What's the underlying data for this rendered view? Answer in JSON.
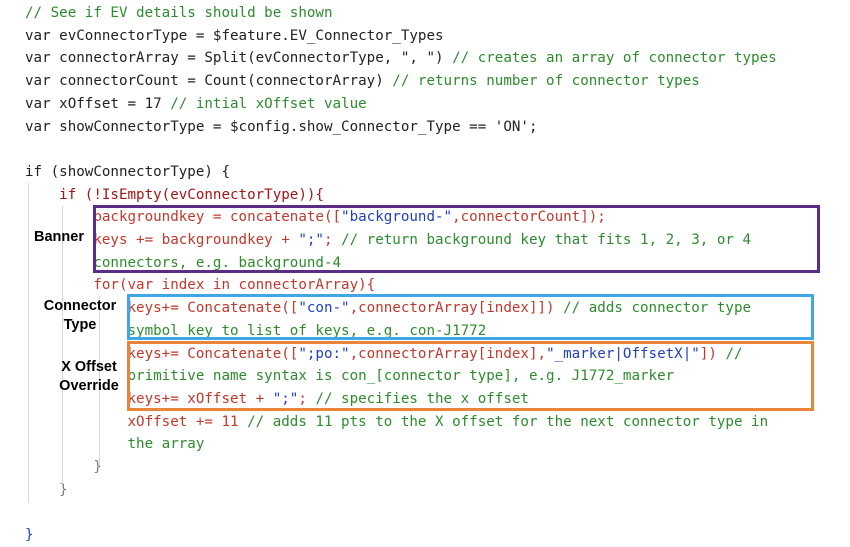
{
  "code": {
    "lines": [
      [
        {
          "t": "// See if EV details should be shown",
          "c": "c-comment"
        }
      ],
      [
        {
          "t": "var evConnectorType = $feature.EV_Connector_Types",
          "c": "c-text"
        }
      ],
      [
        {
          "t": "var connectorArray = Split(evConnectorType, \", \") ",
          "c": "c-text"
        },
        {
          "t": "// creates an array of connector types",
          "c": "c-comment"
        }
      ],
      [
        {
          "t": "var connectorCount = Count(connectorArray) ",
          "c": "c-text"
        },
        {
          "t": "// returns number of connector types",
          "c": "c-comment"
        }
      ],
      [
        {
          "t": "var xOffset = 17 ",
          "c": "c-text"
        },
        {
          "t": "// intial xOffset value",
          "c": "c-comment"
        }
      ],
      [
        {
          "t": "var showConnectorType = $config.show_Connector_Type == 'ON';",
          "c": "c-text"
        }
      ],
      [],
      [
        {
          "t": "if (showConnectorType) {",
          "c": "c-text"
        }
      ],
      [
        {
          "t": "    if (!IsEmpty(evConnectorType)){",
          "c": "c-kw"
        }
      ],
      [
        {
          "t": "        backgroundkey = concatenate([",
          "c": "c-red"
        },
        {
          "t": "\"background-\"",
          "c": "c-blue"
        },
        {
          "t": ",connectorCount]);",
          "c": "c-red"
        }
      ],
      [
        {
          "t": "        keys += backgroundkey + ",
          "c": "c-red"
        },
        {
          "t": "\";\"",
          "c": "c-blue"
        },
        {
          "t": "; ",
          "c": "c-red"
        },
        {
          "t": "// return background key that fits 1, 2, 3, or 4",
          "c": "c-comment"
        }
      ],
      [
        {
          "t": "        connectors, e.g. background-4",
          "c": "c-comment"
        }
      ],
      [
        {
          "t": "        for(var index in connectorArray){",
          "c": "c-red"
        }
      ],
      [
        {
          "t": "            keys+= Concatenate([",
          "c": "c-red"
        },
        {
          "t": "\"con-\"",
          "c": "c-blue"
        },
        {
          "t": ",connectorArray[index]]) ",
          "c": "c-red"
        },
        {
          "t": "// adds connector type",
          "c": "c-comment"
        }
      ],
      [
        {
          "t": "            symbol key to list of keys, e.g. con-J1772",
          "c": "c-comment"
        }
      ],
      [
        {
          "t": "            keys+= Concatenate([",
          "c": "c-red"
        },
        {
          "t": "\";po:\"",
          "c": "c-blue"
        },
        {
          "t": ",connectorArray[index],",
          "c": "c-red"
        },
        {
          "t": "\"_marker|OffsetX|\"",
          "c": "c-blue"
        },
        {
          "t": "]) ",
          "c": "c-red"
        },
        {
          "t": "//",
          "c": "c-comment"
        }
      ],
      [
        {
          "t": "            primitive name syntax is con_[connector type], e.g. J1772_marker",
          "c": "c-comment"
        }
      ],
      [
        {
          "t": "            keys+= xOffset + ",
          "c": "c-red"
        },
        {
          "t": "\";\"",
          "c": "c-blue"
        },
        {
          "t": "; ",
          "c": "c-red"
        },
        {
          "t": "// specifies the x offset",
          "c": "c-comment"
        }
      ],
      [
        {
          "t": "            xOffset += 11 ",
          "c": "c-red"
        },
        {
          "t": "// adds 11 pts to the X offset for the next connector type in",
          "c": "c-comment"
        }
      ],
      [
        {
          "t": "            the array",
          "c": "c-comment"
        }
      ],
      [
        {
          "t": "        }",
          "c": "c-brace"
        }
      ],
      [
        {
          "t": "    }",
          "c": "c-brace"
        }
      ],
      [],
      [
        {
          "t": "}",
          "c": "c-blue"
        }
      ]
    ]
  },
  "annotations": {
    "banner": "Banner",
    "connector_type": "Connector\nType",
    "x_offset_override": "X Offset\nOverride"
  },
  "colors": {
    "banner_box": "#5b2c83",
    "connector_type_box": "#3fa7e6",
    "x_offset_box": "#e8853a"
  }
}
